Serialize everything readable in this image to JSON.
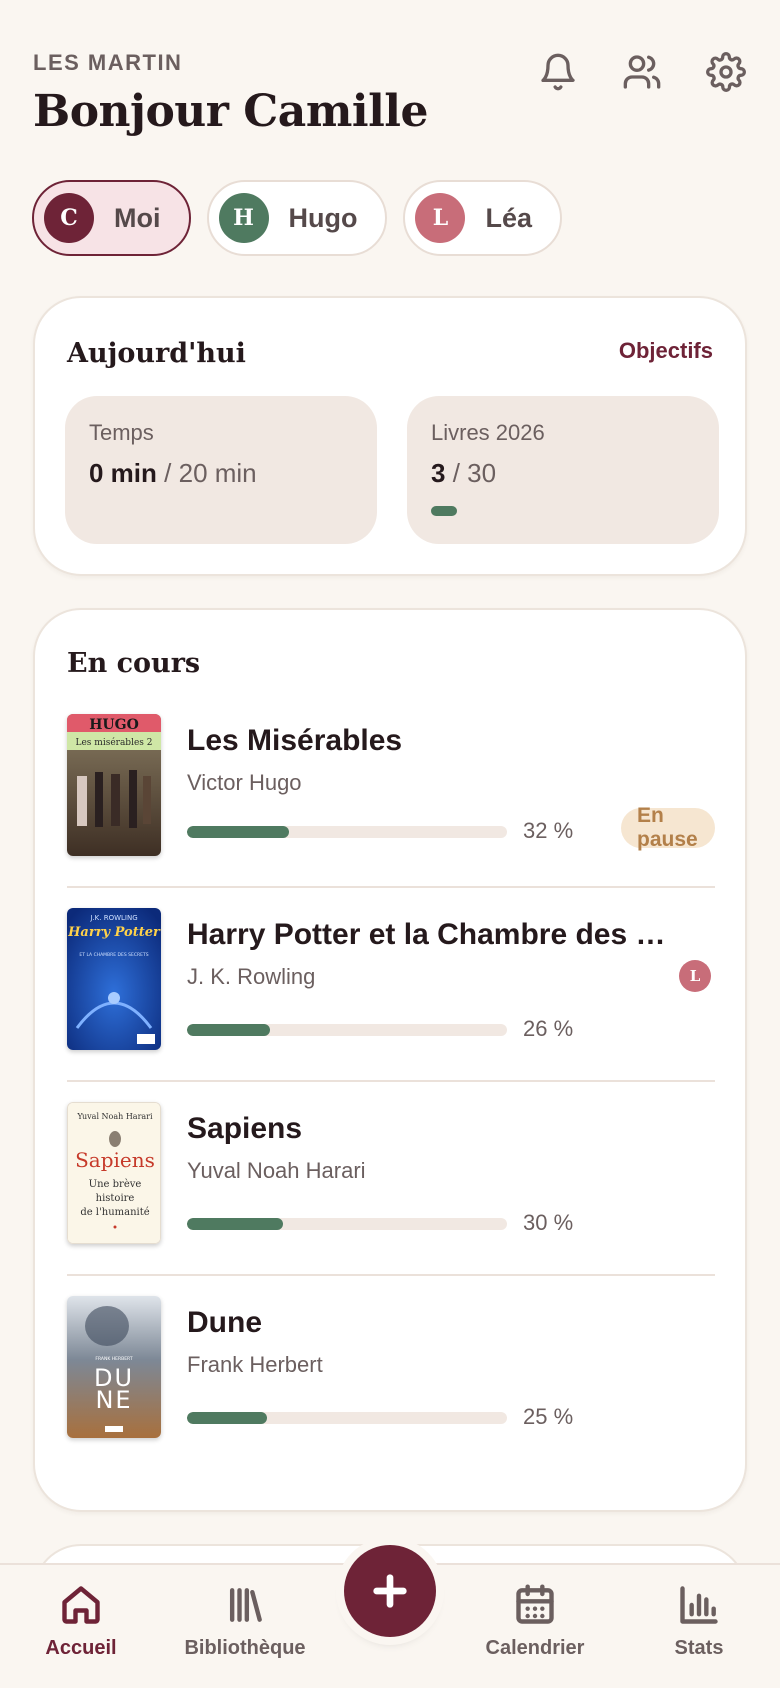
{
  "header": {
    "family_name": "LES MARTIN",
    "greeting": "Bonjour Camille",
    "icons": [
      "bell-icon",
      "users-icon",
      "gear-icon"
    ]
  },
  "members": [
    {
      "initial": "C",
      "label": "Moi",
      "color": "#6e2337",
      "active": true
    },
    {
      "initial": "H",
      "label": "Hugo",
      "color": "#4f7a60",
      "active": false
    },
    {
      "initial": "L",
      "label": "Léa",
      "color": "#c86d79",
      "active": false
    }
  ],
  "today": {
    "title": "Aujourd'hui",
    "link": "Objectifs",
    "time": {
      "label": "Temps",
      "value": "0 min",
      "goal": "/ 20 min"
    },
    "books": {
      "label": "Livres 2026",
      "value": "3",
      "goal": "/ 30",
      "progress": 0.1
    }
  },
  "current": {
    "title": "En cours",
    "books": [
      {
        "title": "Les Misérables",
        "author": "Victor Hugo",
        "progress": 32,
        "progress_label": "32 %",
        "badge": "En pause",
        "reader": ""
      },
      {
        "title": "Harry Potter et la Chambre des …",
        "author": "J. K. Rowling",
        "progress": 26,
        "progress_label": "26 %",
        "badge": "",
        "reader": "L"
      },
      {
        "title": "Sapiens",
        "author": "Yuval Noah Harari",
        "progress": 30,
        "progress_label": "30 %",
        "badge": "",
        "reader": ""
      },
      {
        "title": "Dune",
        "author": "Frank Herbert",
        "progress": 25,
        "progress_label": "25 %",
        "badge": "",
        "reader": ""
      }
    ],
    "covers": {
      "hugo": {
        "brand": "HUGO",
        "subtitle": "Les misérables 2"
      },
      "hp": {
        "author": "J.K. ROWLING",
        "brand": "Harry Potter",
        "subtitle": "ET LA CHAMBRE DES SECRETS"
      },
      "sapiens": {
        "author": "Yuval Noah Harari",
        "title": "Sapiens",
        "sub1": "Une brève",
        "sub2": "histoire",
        "sub3": "de l'humanité"
      },
      "dune": {
        "author": "FRANK HERBERT",
        "title1": "DU",
        "title2": "NE"
      }
    }
  },
  "nav": {
    "items": [
      {
        "label": "Accueil",
        "icon": "home-icon",
        "active": true
      },
      {
        "label": "Bibliothèque",
        "icon": "library-icon",
        "active": false
      },
      {
        "label": "Calendrier",
        "icon": "calendar-icon",
        "active": false
      },
      {
        "label": "Stats",
        "icon": "stats-icon",
        "active": false
      }
    ],
    "fab_icon": "plus-icon"
  },
  "colors": {
    "accent": "#6e2337",
    "green": "#4f7a60",
    "rose": "#c86d79",
    "background": "#faf6f1"
  }
}
